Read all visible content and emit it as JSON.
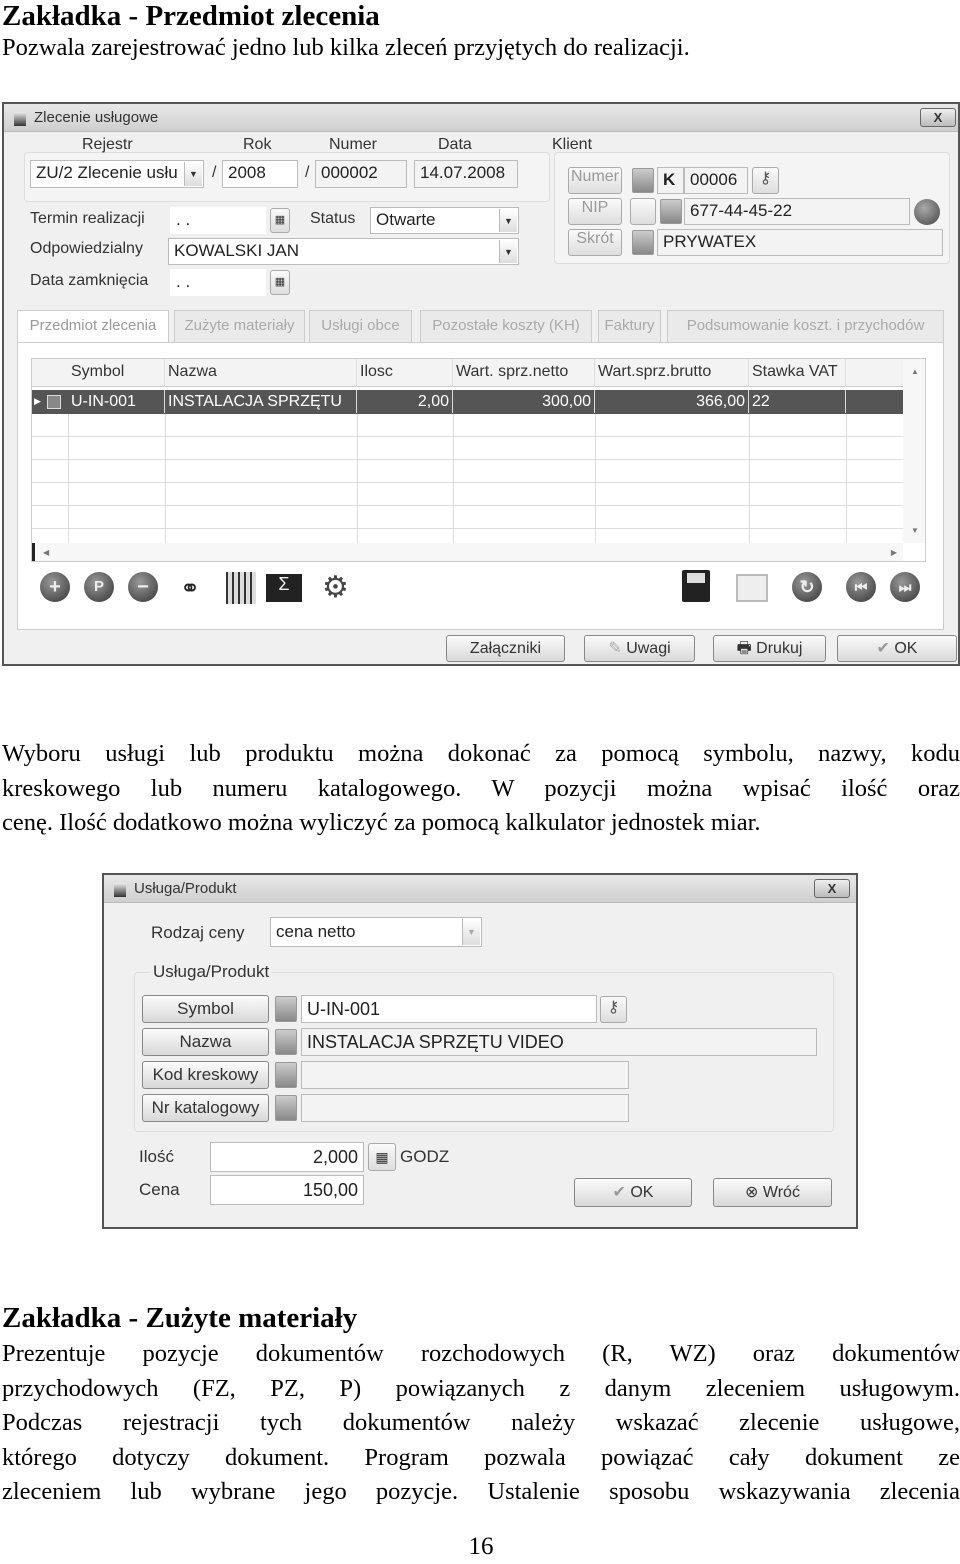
{
  "section1": {
    "heading": "Zakładka - Przedmiot zlecenia",
    "intro": "Pozwala zarejestrować jedno lub kilka zleceń przyjętych do realizacji."
  },
  "window1": {
    "title": "Zlecenie usługowe",
    "close": "X",
    "labels": {
      "rejestr": "Rejestr",
      "rok": "Rok",
      "numer": "Numer",
      "data": "Data",
      "klient": "Klient",
      "termin": "Termin realizacji",
      "status": "Status",
      "odpowiedzialny": "Odpowiedzialny",
      "zamkniecia": "Data zamknięcia",
      "sep": "/"
    },
    "values": {
      "rejestr": "ZU/2  Zlecenie usłu",
      "rok": "2008",
      "numer": "000002",
      "data": "14.07.2008",
      "termin": ". .",
      "status": "Otwarte",
      "odpowiedzialny": "KOWALSKI JAN",
      "zamkniecia": ". ."
    },
    "client": {
      "numer_btn": "Numer",
      "nip_btn": "NIP",
      "skrot_btn": "Skrót",
      "prefix": "K",
      "numer": "00006",
      "nip": "677-44-45-22",
      "skrot": "PRYWATEX"
    },
    "tabs": [
      "Przedmiot zlecenia",
      "Zużyte materiały",
      "Usługi obce",
      "Pozostałe koszty (KH)",
      "Faktury",
      "Podsumowanie koszt. i przychodów"
    ],
    "grid": {
      "columns": [
        "Symbol",
        "Nazwa",
        "Ilosc",
        "Wart. sprz.netto",
        "Wart.sprz.brutto",
        "Stawka VAT"
      ],
      "rows": [
        [
          "U-IN-001",
          "INSTALACJA SPRZĘTU",
          "2,00",
          "300,00",
          "366,00",
          "22"
        ]
      ]
    },
    "buttons": {
      "zalaczniki": "Załączniki",
      "uwagi": "Uwagi",
      "drukuj": "Drukuj",
      "ok": "OK"
    }
  },
  "paragraph1": [
    "Wyboru usługi lub produktu można dokonać za pomocą symbolu, nazwy, kodu",
    "kreskowego lub numeru katalogowego. W pozycji można wpisać ilość oraz",
    "cenę. Ilość dodatkowo można wyliczyć za pomocą kalkulator jednostek miar."
  ],
  "window2": {
    "title": "Usługa/Produkt",
    "close": "X",
    "rodzaj_label": "Rodzaj ceny",
    "rodzaj_value": "cena netto",
    "group_label": "Usługa/Produkt",
    "btn_symbol": "Symbol",
    "btn_nazwa": "Nazwa",
    "btn_kod": "Kod kreskowy",
    "btn_nr": "Nr katalogowy",
    "symbol": "U-IN-001",
    "nazwa": "INSTALACJA SPRZĘTU VIDEO",
    "kod": "",
    "nr": "",
    "ilosc_label": "Ilość",
    "ilosc": "2,000",
    "unit": "GODZ",
    "cena_label": "Cena",
    "cena": "150,00",
    "ok": "OK",
    "wroc": "Wróć"
  },
  "section2": {
    "heading": "Zakładka - Zużyte materiały",
    "lines": [
      "Prezentuje pozycje dokumentów rozchodowych (R, WZ) oraz dokumentów",
      "przychodowych (FZ, PZ, P) powiązanych z danym zleceniem usługowym.",
      "Podczas rejestracji tych dokumentów należy wskazać zlecenie usługowe,",
      "którego dotyczy dokument. Program pozwala powiązać cały dokument ze",
      "zleceniem lub wybrane jego pozycje. Ustalenie sposobu wskazywania zlecenia"
    ]
  },
  "page_number": "16"
}
